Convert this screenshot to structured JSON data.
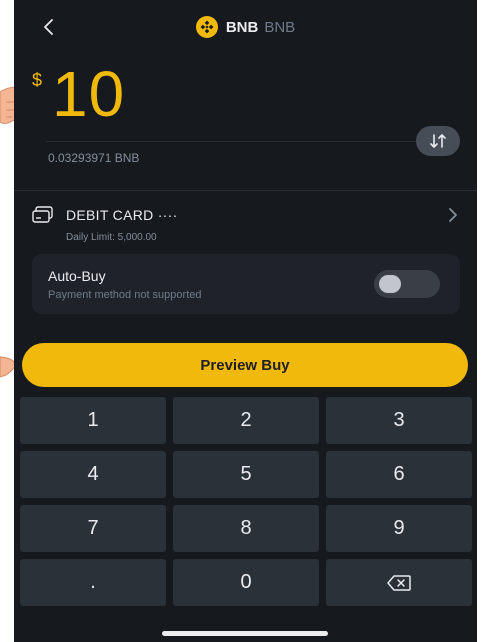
{
  "header": {
    "title": "BNB",
    "subtitle": "BNB",
    "back_icon": "chevron-left-icon",
    "coin_icon": "bnb-coin-icon"
  },
  "amount": {
    "currency_symbol": "$",
    "value": "10",
    "crypto_equivalent": "0.03293971 BNB",
    "swap_icon": "swap-arrows-icon"
  },
  "payment_method": {
    "label": "DEBIT CARD ····",
    "limit": "Daily Limit: 5,000.00",
    "icon": "card-icon",
    "chevron": "chevron-right-icon"
  },
  "auto_buy": {
    "title": "Auto-Buy",
    "subtitle": "Payment method not supported",
    "enabled": false
  },
  "preview_button": {
    "label": "Preview Buy"
  },
  "keypad": {
    "keys": [
      "1",
      "2",
      "3",
      "4",
      "5",
      "6",
      "7",
      "8",
      "9",
      ".",
      "0"
    ],
    "delete_icon": "backspace-icon"
  },
  "colors": {
    "background": "#16191e",
    "accent": "#f0b90b",
    "key_bg": "#2b3139",
    "card_bg": "#1f2329",
    "text_primary": "#eaecef",
    "text_secondary": "#848e9c"
  }
}
